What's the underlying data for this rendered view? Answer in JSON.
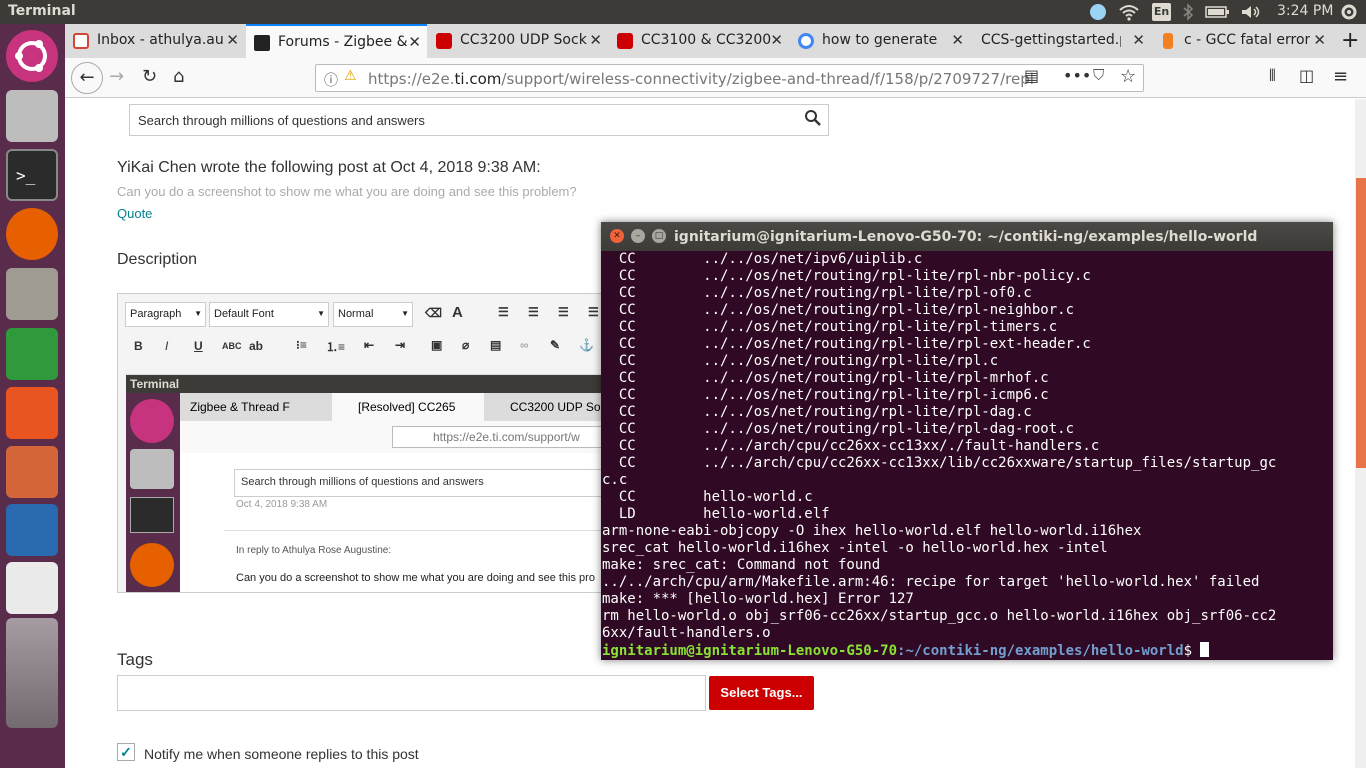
{
  "top_panel": {
    "title": "Terminal",
    "keyboard": "En",
    "clock": "3:24 PM"
  },
  "browser": {
    "tabs": [
      {
        "label": "Inbox - athulya.au",
        "icon": "gmail-icon"
      },
      {
        "label": "Forums - Zigbee &",
        "icon": "ti-icon"
      },
      {
        "label": "CC3200 UDP Sock",
        "icon": "ti-red-icon"
      },
      {
        "label": "CC3100 & CC3200",
        "icon": "ti-red-icon"
      },
      {
        "label": "how to generate",
        "icon": "google-icon"
      },
      {
        "label": "CCS-gettingstarted.p",
        "icon": "pdf-icon"
      },
      {
        "label": "c - GCC fatal error",
        "icon": "stackoverflow-icon"
      }
    ],
    "url_prefix": "https://e2e.",
    "url_domain": "ti.com",
    "url_rest": "/support/wireless-connectivity/zigbee-and-thread/f/158/p/2709727/repl"
  },
  "page": {
    "search_placeholder": "Search through millions of questions and answers",
    "quote_header": "YiKai Chen wrote the following post at Oct 4, 2018 9:38 AM:",
    "quote_text": "Can you do a screenshot to show me what you are doing and see this problem?",
    "quote_link": "Quote",
    "description_label": "Description",
    "toolbar": {
      "format": "Paragraph",
      "font": "Default Font",
      "size": "Normal"
    },
    "inner_shot": {
      "title": "Terminal",
      "tabs": [
        "Zigbee & Thread F",
        "[Resolved] CC265",
        "CC3200 UDP Soc"
      ],
      "url": "https://e2e.ti.com/support/w",
      "search": "Search through millions of questions and answers",
      "date": "Oct 4, 2018 9:38 AM",
      "reply_to": "In reply to Athulya Rose Augustine:",
      "body": "Can you do a screenshot to show me what you are doing and see this pro"
    },
    "tags_label": "Tags",
    "select_tags": "Select Tags...",
    "notify": "Notify me when someone replies to this post"
  },
  "terminal": {
    "title": "ignitarium@ignitarium-Lenovo-G50-70: ~/contiki-ng/examples/hello-world",
    "lines": [
      "  CC        ../../os/net/ipv6/uiplib.c",
      "  CC        ../../os/net/routing/rpl-lite/rpl-nbr-policy.c",
      "  CC        ../../os/net/routing/rpl-lite/rpl-of0.c",
      "  CC        ../../os/net/routing/rpl-lite/rpl-neighbor.c",
      "  CC        ../../os/net/routing/rpl-lite/rpl-timers.c",
      "  CC        ../../os/net/routing/rpl-lite/rpl-ext-header.c",
      "  CC        ../../os/net/routing/rpl-lite/rpl.c",
      "  CC        ../../os/net/routing/rpl-lite/rpl-mrhof.c",
      "  CC        ../../os/net/routing/rpl-lite/rpl-icmp6.c",
      "  CC        ../../os/net/routing/rpl-lite/rpl-dag.c",
      "  CC        ../../os/net/routing/rpl-lite/rpl-dag-root.c",
      "  CC        ../../arch/cpu/cc26xx-cc13xx/./fault-handlers.c",
      "  CC        ../../arch/cpu/cc26xx-cc13xx/lib/cc26xxware/startup_files/startup_gc",
      "c.c",
      "  CC        hello-world.c",
      "  LD        hello-world.elf",
      "arm-none-eabi-objcopy -O ihex hello-world.elf hello-world.i16hex",
      "srec_cat hello-world.i16hex -intel -o hello-world.hex -intel",
      "make: srec_cat: Command not found",
      "../../arch/cpu/arm/Makefile.arm:46: recipe for target 'hello-world.hex' failed",
      "make: *** [hello-world.hex] Error 127",
      "rm hello-world.o obj_srf06-cc26xx/startup_gcc.o hello-world.i16hex obj_srf06-cc2",
      "6xx/fault-handlers.o"
    ],
    "prompt_user": "ignitarium@ignitarium-Lenovo-G50-70",
    "prompt_path": ":~/contiki-ng/examples/hello-world",
    "prompt_end": "$ "
  }
}
